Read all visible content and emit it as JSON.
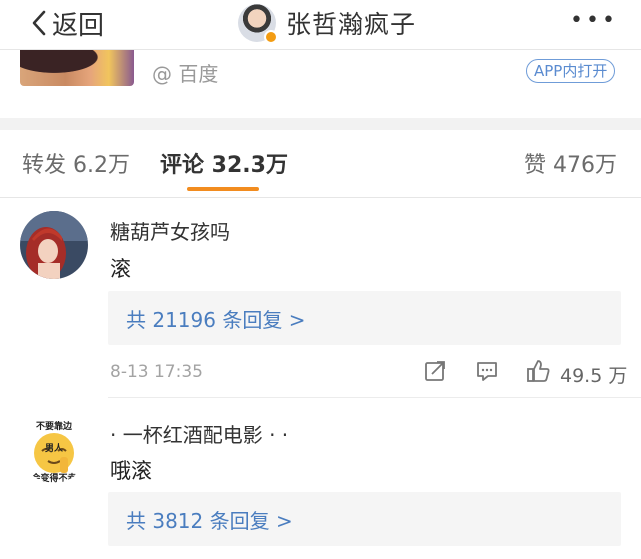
{
  "header": {
    "back_label": "返回",
    "title": "张哲瀚疯子",
    "more_label": "•••"
  },
  "card": {
    "source": "@ 百度",
    "app_open_label": "APP内打开"
  },
  "tabs": [
    {
      "label": "转发 6.2万",
      "active": false
    },
    {
      "label": "评论 32.3万",
      "active": true
    },
    {
      "label": "赞 476万",
      "active": false
    }
  ],
  "comments": [
    {
      "name": "糖葫芦女孩吗",
      "text": "滚",
      "replies_label": "共 21196 条回复 >",
      "time": "8-13 17:35",
      "likes": "49.5 万"
    },
    {
      "name": "· 一杯红酒配电影 · ·",
      "text": "哦滚",
      "replies_label": "共 3812 条回复 >",
      "avatar_text_top": "不要靠边",
      "avatar_text_mid": "男人",
      "avatar_text_bottom": "会变得不幸"
    }
  ],
  "colors": {
    "accent": "#f28c1f",
    "link": "#4a7dbf",
    "app_button": "#5a8bd0",
    "verified": "#f39c12"
  }
}
